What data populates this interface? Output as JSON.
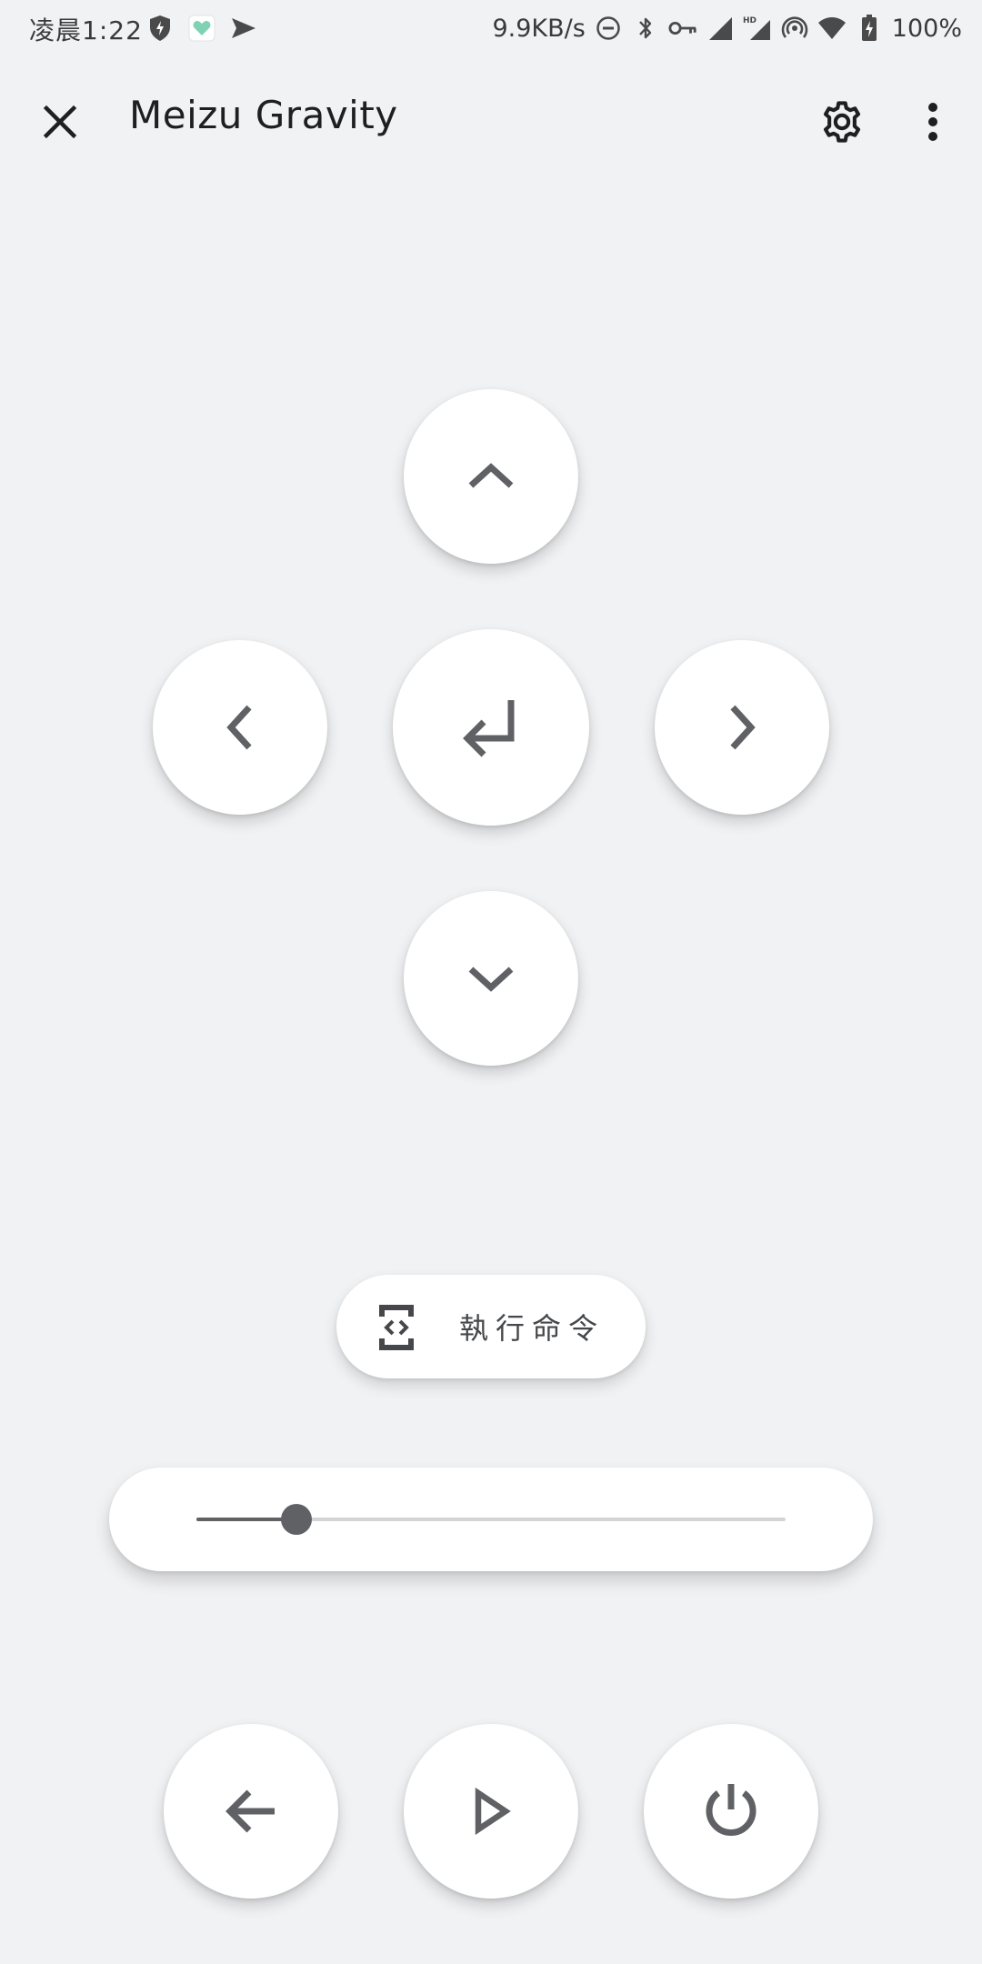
{
  "status_bar": {
    "time": "凌晨1:22",
    "network_speed": "9.9KB/s",
    "battery": "100%",
    "left_icons": [
      "security-shield-icon",
      "heart-app-icon",
      "send-icon"
    ],
    "right_icons": [
      "do-not-disturb-icon",
      "bluetooth-icon",
      "vpn-key-icon",
      "signal-hd-icon",
      "signal-icon",
      "hotspot-icon",
      "wifi-icon",
      "battery-charging-icon"
    ]
  },
  "app_bar": {
    "title": "Meizu Gravity",
    "close_icon": "close-icon",
    "settings_icon": "gear-icon",
    "more_icon": "more-vert-icon"
  },
  "dpad": {
    "up_icon": "chevron-up-icon",
    "left_icon": "chevron-left-icon",
    "enter_icon": "enter-return-icon",
    "right_icon": "chevron-right-icon",
    "down_icon": "chevron-down-icon"
  },
  "execute": {
    "label": "執行命令",
    "icon": "code-brackets-icon"
  },
  "slider": {
    "value_fraction": 0.17
  },
  "bottom_controls": {
    "back_icon": "arrow-back-icon",
    "play_icon": "play-icon",
    "power_icon": "power-icon"
  },
  "colors": {
    "background": "#f1f2f4",
    "surface": "#ffffff",
    "icon": "#5f6164",
    "title": "#1f1f1f"
  }
}
